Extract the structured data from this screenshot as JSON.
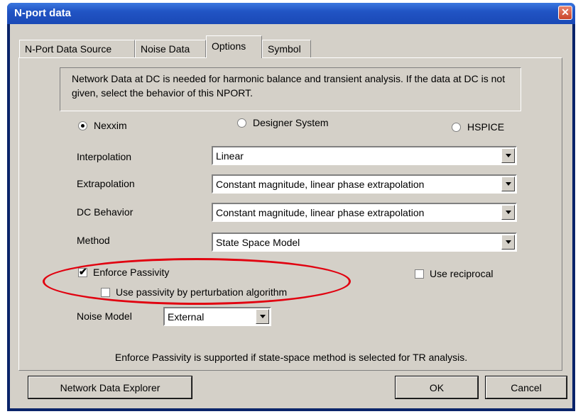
{
  "window": {
    "title": "N-port data",
    "close_glyph": "✕"
  },
  "tabs": [
    {
      "label": "N-Port Data Source",
      "active": false
    },
    {
      "label": "Noise Data",
      "active": false
    },
    {
      "label": "Options",
      "active": true
    },
    {
      "label": "Symbol",
      "active": false
    }
  ],
  "info_text": "Network Data at DC is needed for harmonic balance and transient analysis. If the data at DC is not given, select the behavior of this NPORT.",
  "simulators": [
    {
      "label": "Nexxim",
      "selected": true
    },
    {
      "label": "Designer System",
      "selected": false
    },
    {
      "label": "HSPICE",
      "selected": false
    }
  ],
  "fields": {
    "interpolation": {
      "label": "Interpolation",
      "value": "Linear"
    },
    "extrapolation": {
      "label": "Extrapolation",
      "value": "Constant magnitude, linear phase extrapolation"
    },
    "dc_behavior": {
      "label": "DC Behavior",
      "value": "Constant magnitude, linear phase extrapolation"
    },
    "method": {
      "label": "Method",
      "value": "State Space Model"
    }
  },
  "checks": {
    "enforce_passivity": {
      "label": "Enforce Passivity",
      "checked": true
    },
    "perturbation": {
      "label": "Use passivity by perturbation algorithm",
      "checked": false
    },
    "reciprocal": {
      "label": "Use reciprocal",
      "checked": false
    }
  },
  "noise_model": {
    "label": "Noise Model",
    "value": "External"
  },
  "note": "Enforce Passivity is supported if state-space method is selected for TR analysis.",
  "buttons": {
    "explorer": "Network Data Explorer",
    "ok": "OK",
    "cancel": "Cancel"
  },
  "colors": {
    "titlebar": "#2154c4",
    "face": "#d4d0c8",
    "highlight_ellipse": "#e1000f"
  }
}
